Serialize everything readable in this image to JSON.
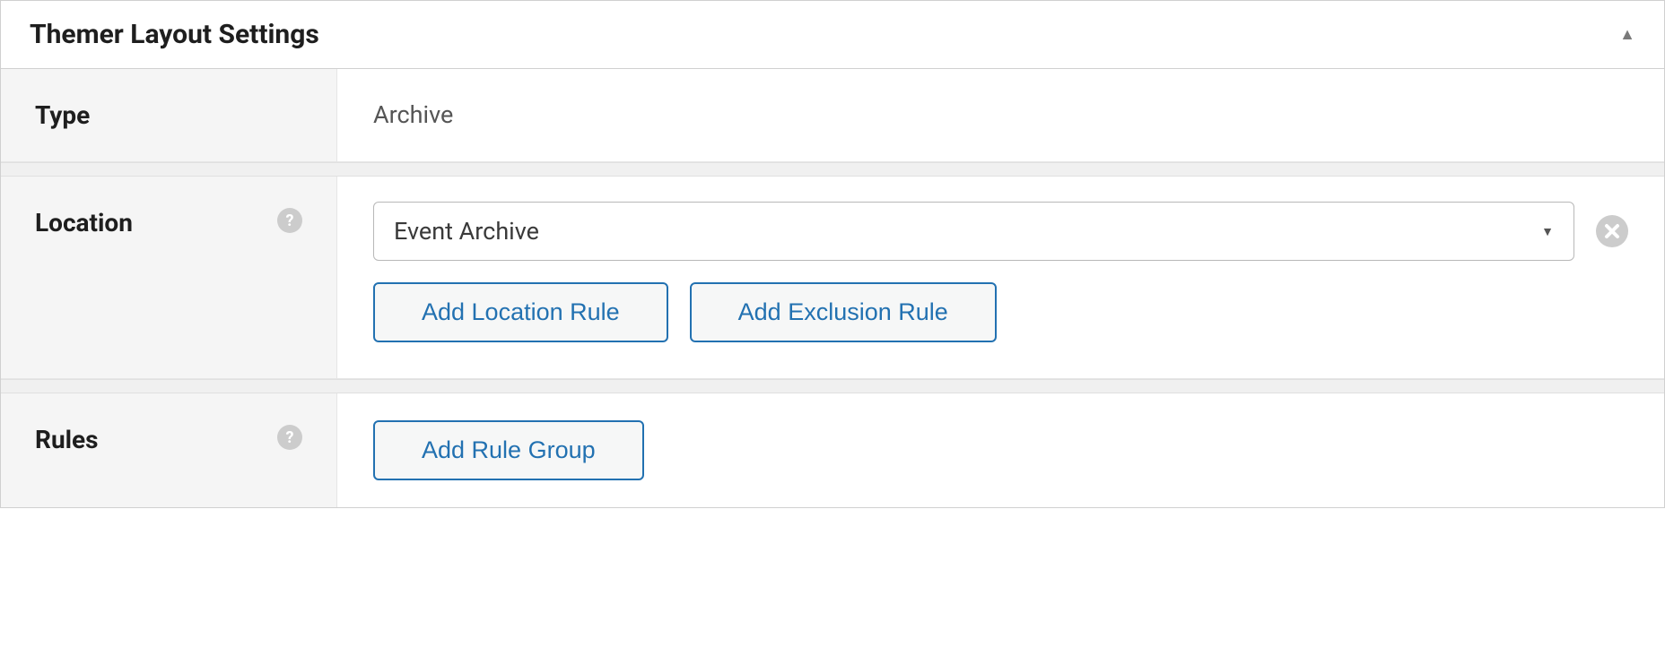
{
  "panel": {
    "title": "Themer Layout Settings"
  },
  "rows": {
    "type": {
      "label": "Type",
      "value": "Archive"
    },
    "location": {
      "label": "Location",
      "select_value": "Event Archive",
      "add_location_button": "Add Location Rule",
      "add_exclusion_button": "Add Exclusion Rule"
    },
    "rules": {
      "label": "Rules",
      "add_rule_group_button": "Add Rule Group"
    }
  }
}
